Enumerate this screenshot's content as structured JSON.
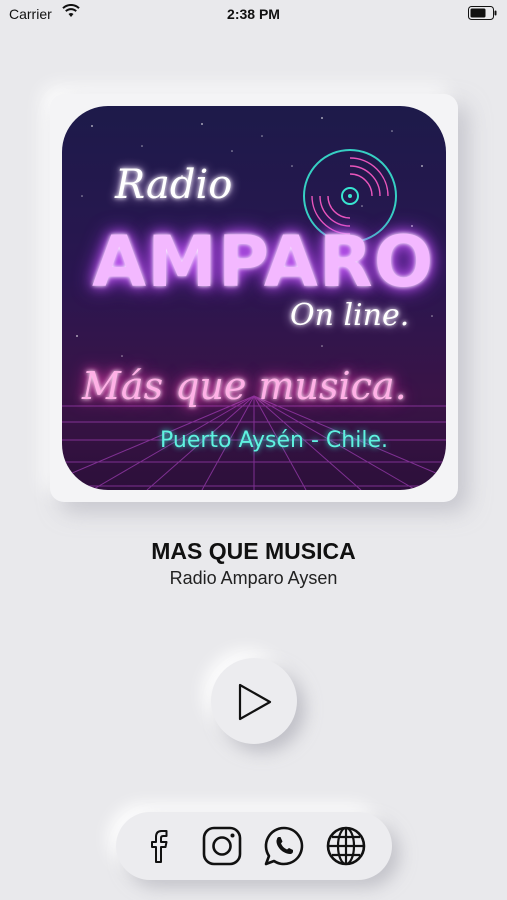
{
  "status_bar": {
    "carrier": "Carrier",
    "time": "2:38 PM"
  },
  "artwork": {
    "radio": "Radio",
    "station": "AMPARO",
    "online": "On line.",
    "slogan": "Más que musica.",
    "location": "Puerto Aysén - Chile."
  },
  "now_playing": {
    "title": "MAS QUE MUSICA",
    "subtitle": "Radio Amparo Aysen"
  },
  "controls": {
    "play_icon": "play-icon"
  },
  "social": [
    "facebook-icon",
    "instagram-icon",
    "whatsapp-icon",
    "globe-icon"
  ],
  "colors": {
    "background": "#e9e9ec",
    "neon_purple": "#d56bff",
    "neon_pink": "#ff5cc8",
    "neon_teal": "#38e4d0"
  }
}
